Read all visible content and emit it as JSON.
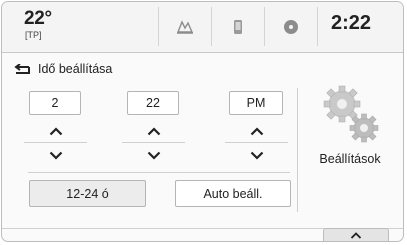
{
  "status": {
    "temperature": "22°",
    "temperature_source": "[TP]",
    "clock": "2:22",
    "tabs": [
      {
        "icon": "navigation-map-icon"
      },
      {
        "icon": "phone-icon"
      },
      {
        "icon": "media-disc-icon"
      }
    ]
  },
  "header": {
    "title": "Idő beállítása",
    "back_icon": "back-arrow-icon"
  },
  "time": {
    "hour": "2",
    "minute": "22",
    "period": "PM"
  },
  "buttons": {
    "format_label": "12-24 ó",
    "auto_label": "Auto beáll."
  },
  "settings": {
    "label": "Beállítások",
    "icon": "gears-icon"
  },
  "colors": {
    "screen_bg": "#fafafa",
    "icon_grey": "#8c8c8c",
    "arrow_dark": "#222222"
  }
}
